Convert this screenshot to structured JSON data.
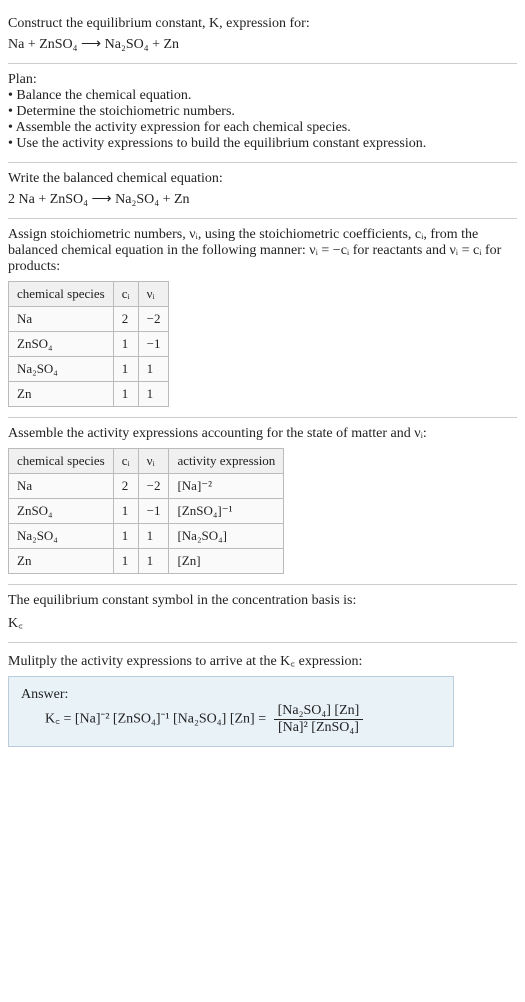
{
  "s1": {
    "title": "Construct the equilibrium constant, K, expression for:",
    "eq": "Na + ZnSO₄  ⟶  Na₂SO₄ + Zn"
  },
  "s2": {
    "title": "Plan:",
    "b1": "• Balance the chemical equation.",
    "b2": "• Determine the stoichiometric numbers.",
    "b3": "• Assemble the activity expression for each chemical species.",
    "b4": "• Use the activity expressions to build the equilibrium constant expression."
  },
  "s3": {
    "title": "Write the balanced chemical equation:",
    "eq": "2 Na + ZnSO₄  ⟶  Na₂SO₄ + Zn"
  },
  "s4": {
    "title": "Assign stoichiometric numbers, νᵢ, using the stoichiometric coefficients, cᵢ, from the balanced chemical equation in the following manner: νᵢ = −cᵢ for reactants and νᵢ = cᵢ for products:",
    "head": {
      "c1": "chemical species",
      "c2": "cᵢ",
      "c3": "νᵢ"
    },
    "r1": {
      "sp": "Na",
      "c": "2",
      "v": "−2"
    },
    "r2": {
      "sp": "ZnSO₄",
      "c": "1",
      "v": "−1"
    },
    "r3": {
      "sp": "Na₂SO₄",
      "c": "1",
      "v": "1"
    },
    "r4": {
      "sp": "Zn",
      "c": "1",
      "v": "1"
    }
  },
  "s5": {
    "title": "Assemble the activity expressions accounting for the state of matter and νᵢ:",
    "head": {
      "c1": "chemical species",
      "c2": "cᵢ",
      "c3": "νᵢ",
      "c4": "activity expression"
    },
    "r1": {
      "sp": "Na",
      "c": "2",
      "v": "−2",
      "a": "[Na]⁻²"
    },
    "r2": {
      "sp": "ZnSO₄",
      "c": "1",
      "v": "−1",
      "a": "[ZnSO₄]⁻¹"
    },
    "r3": {
      "sp": "Na₂SO₄",
      "c": "1",
      "v": "1",
      "a": "[Na₂SO₄]"
    },
    "r4": {
      "sp": "Zn",
      "c": "1",
      "v": "1",
      "a": "[Zn]"
    }
  },
  "s6": {
    "title": "The equilibrium constant symbol in the concentration basis is:",
    "sym": "K꜀"
  },
  "s7": {
    "title": "Mulitply the activity expressions to arrive at the K꜀ expression:",
    "answer_label": "Answer:",
    "lhs": "K꜀ = [Na]⁻² [ZnSO₄]⁻¹ [Na₂SO₄] [Zn] = ",
    "num": "[Na₂SO₄] [Zn]",
    "den": "[Na]² [ZnSO₄]"
  }
}
